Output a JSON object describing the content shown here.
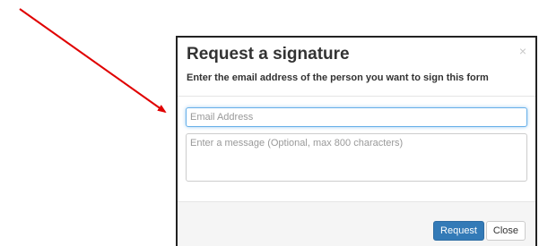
{
  "modal": {
    "title": "Request a signature",
    "subtitle": "Enter the email address of the person you want to sign this form",
    "close_symbol": "×",
    "email_placeholder": "Email Address",
    "message_placeholder": "Enter a message (Optional, max 800 characters)",
    "request_label": "Request",
    "close_label": "Close"
  },
  "annotation": {
    "arrow_color": "#e00000"
  },
  "colors": {
    "primary_button": "#337ab7",
    "focus_border": "#66afe9",
    "footer_bg": "#f5f5f5"
  }
}
